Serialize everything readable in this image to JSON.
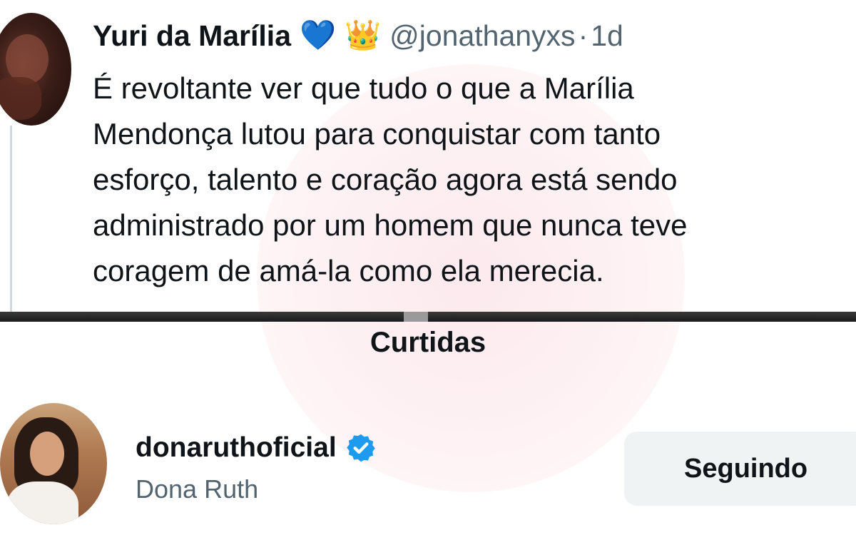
{
  "tweet": {
    "display_name": "Yuri da Marília",
    "badges": [
      "💙",
      "👑"
    ],
    "handle": "@jonathanyxs",
    "separator": "·",
    "time": "1d",
    "text_lines": [
      "É revoltante ver que tudo o que a Marília",
      "Mendonça lutou para conquistar com tanto",
      "esforço, talento e coração agora está sendo",
      "administrado por um homem que nunca teve",
      "coragem de amá-la como ela merecia."
    ]
  },
  "likes_section": {
    "title": "Curtidas"
  },
  "liker": {
    "username": "donaruthoficial",
    "name": "Dona Ruth",
    "verified_icon": "verified-badge-icon",
    "follow_button_label": "Seguindo"
  },
  "colors": {
    "text": "#0f1419",
    "secondary": "#536471",
    "verified": "#1d9bf0",
    "button_bg": "#eff3f4",
    "watermark": "#fad7de"
  }
}
